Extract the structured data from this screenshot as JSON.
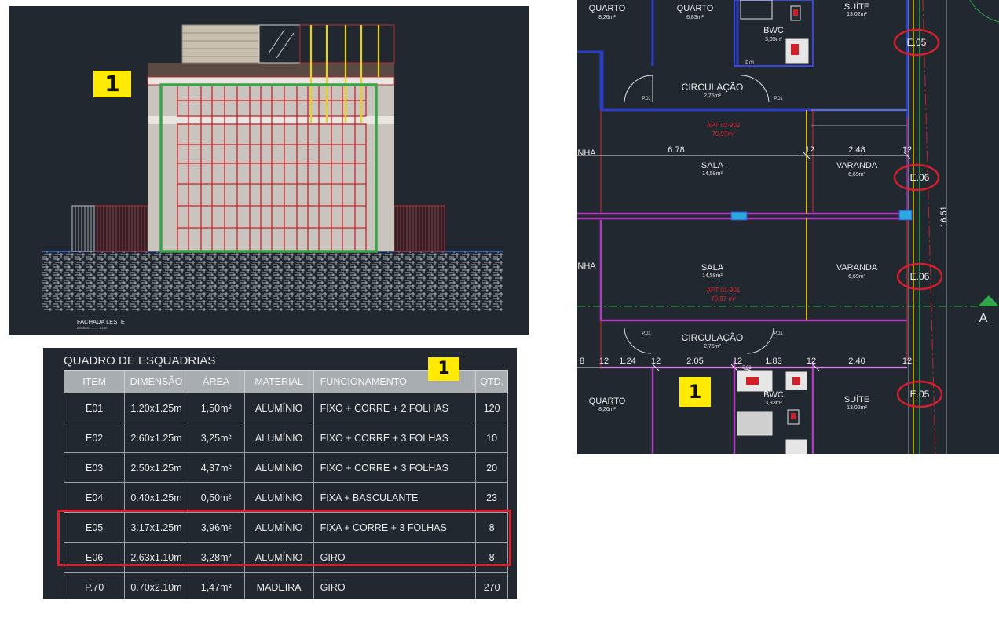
{
  "elevation": {
    "badge": "1",
    "caption": "FACHADA LESTE",
    "scale": "ESCALA ........... 1:100"
  },
  "schedule": {
    "title": "QUADRO DE ESQUADRIAS",
    "badge": "1",
    "headers": [
      "ITEM",
      "DIMENSÃO",
      "ÁREA",
      "MATERIAL",
      "FUNCIONAMENTO",
      "QTD."
    ],
    "rows": [
      [
        "E01",
        "1.20x1.25m",
        "1,50m²",
        "ALUMÍNIO",
        "FIXO + CORRE + 2 FOLHAS",
        "120"
      ],
      [
        "E02",
        "2.60x1.25m",
        "3,25m²",
        "ALUMÍNIO",
        "FIXO + CORRE + 3 FOLHAS",
        "10"
      ],
      [
        "E03",
        "2.50x1.25m",
        "4,37m²",
        "ALUMÍNIO",
        "FIXO + CORRE + 3 FOLHAS",
        "20"
      ],
      [
        "E04",
        "0.40x1.25m",
        "0,50m²",
        "ALUMÍNIO",
        "FIXA + BASCULANTE",
        "23"
      ],
      [
        "E05",
        "3.17x1.25m",
        "3,96m²",
        "ALUMÍNIO",
        "FIXA + CORRE + 3 FOLHAS",
        "8"
      ],
      [
        "E06",
        "2.63x1.10m",
        "3,28m²",
        "ALUMÍNIO",
        "GIRO",
        "8"
      ],
      [
        "P.70",
        "0.70x2.10m",
        "1,47m²",
        "MADEIRA",
        "GIRO",
        "270"
      ]
    ],
    "highlight_color": "#d81e2c"
  },
  "plan": {
    "badge": "1",
    "rooms": {
      "quarto_top": "QUARTO",
      "quarto_top_area": "8,26m²",
      "quarto2_top": "QUARTO",
      "quarto2_top_area": "6,83m²",
      "suite_top": "SUÍTE",
      "suite_top_area": "13,02m²",
      "bwc_top": "BWC",
      "bwc_top_area": "3,05m²",
      "circ_top": "CIRCULAÇÃO",
      "circ_top_area": "2,75m²",
      "apt_top": "APT 02-902",
      "apt_top_area": "70,97m²",
      "sala_top": "SALA",
      "sala_top_area": "14,58m²",
      "varanda_top": "VARANDA",
      "varanda_top_area": "6,69m²",
      "sala_bot": "SALA",
      "sala_bot_area": "14,58m²",
      "varanda_bot": "VARANDA",
      "varanda_bot_area": "6,69m²",
      "apt_bot": "APT 01-901",
      "apt_bot_area": "70,97 m²",
      "circ_bot": "CIRCULAÇÃO",
      "circ_bot_area": "2,75m²",
      "bwc_bot": "BWC",
      "bwc_bot_area": "3,33m²",
      "quarto_bot": "QUARTO",
      "quarto_bot_area": "8,26m²",
      "suite_bot": "SUÍTE",
      "suite_bot_area": "13,02m²",
      "nha1": "NHA",
      "nha2": "NHA"
    },
    "dims": {
      "d678": "6.78",
      "d12a": "12",
      "d248": "2.48",
      "d12b": "12",
      "d1651": "16.51",
      "d12c": "12",
      "d124": "1.24",
      "d12d": "12",
      "d205": "2.05",
      "d12e": "12",
      "d183": "1.83",
      "d12f": "12",
      "d240": "2.40",
      "d12g": "12",
      "d8": "8"
    },
    "tags": {
      "e05a": "E.05",
      "e06a": "E.06",
      "e06b": "E.06",
      "e05b": "E.05"
    },
    "doors": {
      "p01a": "P.01",
      "p01b": "P.01",
      "p01c": "P.01",
      "p01d": "P.01",
      "p01e": "P.01",
      "p01f": "P.01",
      "p01g": "P.01"
    },
    "section_label": "A",
    "tag_circle_color": "#d81e2c"
  }
}
